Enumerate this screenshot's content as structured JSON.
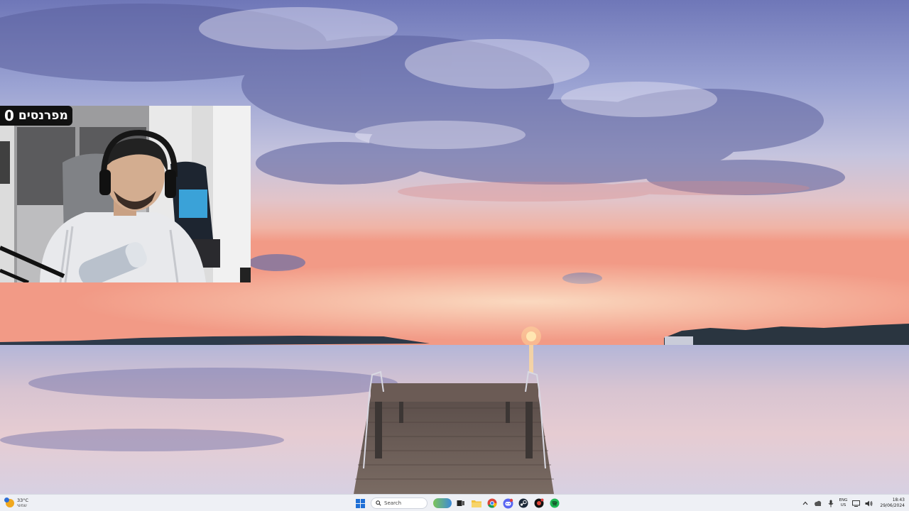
{
  "overlay": {
    "sponsor_label": "מפרנסים",
    "sponsor_count": "0"
  },
  "taskbar": {
    "weather": {
      "temp": "33°C",
      "condition": "שמשי"
    },
    "search_placeholder": "Search",
    "pinned_icons": [
      "windows-start-icon",
      "search-icon",
      "task-view-icon",
      "file-explorer-icon",
      "chrome-icon",
      "discord-icon",
      "steam-icon",
      "game-app-icon",
      "spotify-icon"
    ],
    "tray": {
      "lang_primary": "ENG",
      "lang_secondary": "US",
      "time": "18:43",
      "date": "29/06/2024"
    }
  },
  "colors": {
    "taskbar_bg": "#eef0f5",
    "badge_bg": "#111111",
    "spotify": "#1db954",
    "windows_blue": "#1f6fd6"
  }
}
